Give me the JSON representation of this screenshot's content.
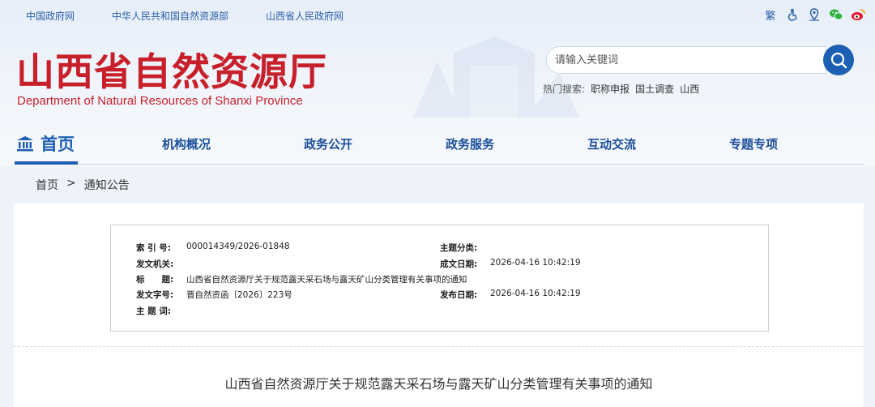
{
  "top_links": [
    "中国政府网",
    "中华人民共和国自然资源部",
    "山西省人民政府网"
  ],
  "tools": {
    "traditional": "繁"
  },
  "site": {
    "name_cn": "山西省自然资源厅",
    "name_en": "Department of Natural Resources of Shanxi Province"
  },
  "search": {
    "placeholder": "请输入关键词",
    "hot_label": "热门搜索:",
    "hot_items": [
      "职称申报",
      "国土调查",
      "山西"
    ]
  },
  "nav": {
    "home": "首页",
    "items": [
      "机构概况",
      "政务公开",
      "政务服务",
      "互动交流",
      "专题专项"
    ]
  },
  "breadcrumb": {
    "home": "首页",
    "sep": ">",
    "current": "通知公告"
  },
  "info": {
    "index_label": "索 引 号:",
    "index_value": "000014349/2026-01848",
    "category_label": "主题分类:",
    "category_value": "",
    "issuer_label": "发文机关:",
    "issuer_value": "",
    "created_label": "成文日期:",
    "created_value": "2026-04-16 10:42:19",
    "title_label": "标　　题:",
    "title_value": "山西省自然资源厅关于规范露天采石场与露天矿山分类管理有关事项的通知",
    "docno_label": "发文字号:",
    "docno_value": "晋自然资函〔2026〕223号",
    "published_label": "发布日期:",
    "published_value": "2026-04-16 10:42:19",
    "keywords_label": "主 题 词:",
    "keywords_value": ""
  },
  "document": {
    "title": "山西省自然资源厅关于规范露天采石场与露天矿山分类管理有关事项的通知"
  },
  "colors": {
    "brand_red": "#c8202a",
    "brand_blue": "#1d5fb2",
    "nav_text": "#1b4f98"
  }
}
